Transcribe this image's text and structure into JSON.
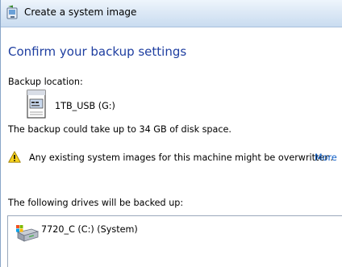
{
  "window": {
    "title": "Create a system image"
  },
  "main": {
    "heading": "Confirm your backup settings",
    "backup_location_label": "Backup location:",
    "backup_location_value": "1TB_USB (G:)",
    "space_note": "The backup could take up to 34 GB of disk space.",
    "warning_text": "Any existing system images for this machine might be overwritten.",
    "more_link": "More",
    "drives_label": "The following drives will be backed up:",
    "drives": [
      {
        "label": "7720_C (C:) (System)"
      }
    ]
  },
  "icons": {
    "back": "back-arrow-icon",
    "backup_drive": "usb-drive-icon",
    "warning": "warning-icon",
    "hard_disk": "hard-disk-icon"
  },
  "colors": {
    "heading": "#1e3ea0",
    "link": "#1060c8",
    "titlebar": "#dde9f6"
  }
}
